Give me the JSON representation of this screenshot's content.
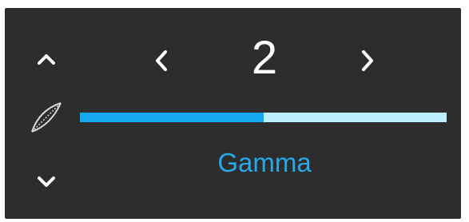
{
  "panel": {
    "up_icon": "chevron-up-icon",
    "curve_icon": "gamma-curve-icon",
    "down_icon": "chevron-down-icon"
  },
  "selector": {
    "prev_icon": "chevron-left-icon",
    "next_icon": "chevron-right-icon",
    "value": "2"
  },
  "slider": {
    "fraction": 0.5
  },
  "setting": {
    "label": "Gamma"
  },
  "colors": {
    "background": "#2d2d2d",
    "accent": "#14a8ef",
    "track": "#bfeeff",
    "label": "#27a9e8",
    "icon": "#ffffff"
  }
}
